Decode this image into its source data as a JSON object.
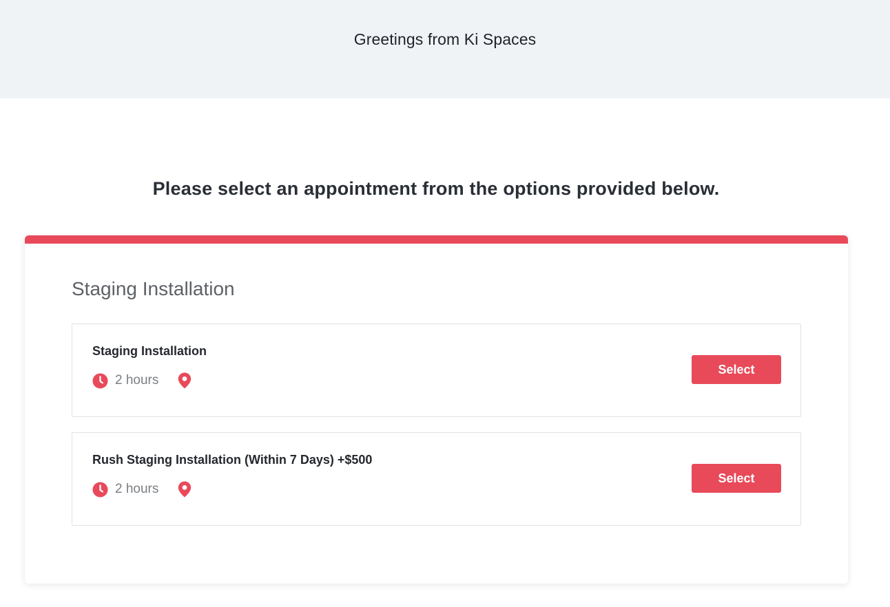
{
  "header": {
    "greeting": "Greetings from Ki Spaces",
    "background_color": "#f0f3f6"
  },
  "main": {
    "heading": "Please select an appointment from the options provided below."
  },
  "card": {
    "title": "Staging Installation",
    "accent_color": "#e84a5a",
    "options": [
      {
        "name": "Staging Installation",
        "duration": "2 hours",
        "duration_icon": "clock-icon",
        "location_icon": "map-pin-icon",
        "button_label": "Select"
      },
      {
        "name": "Rush Staging Installation (Within 7 Days) +$500",
        "duration": "2 hours",
        "duration_icon": "clock-icon",
        "location_icon": "map-pin-icon",
        "button_label": "Select"
      }
    ]
  }
}
